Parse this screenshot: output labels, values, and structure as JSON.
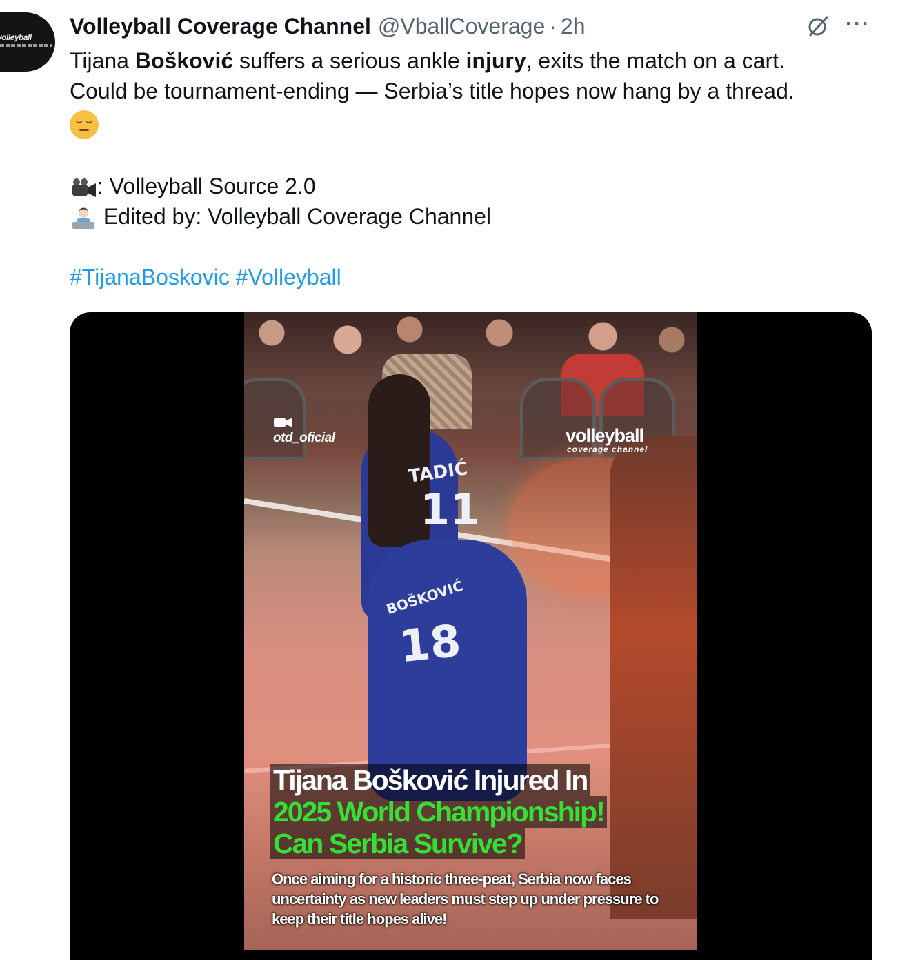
{
  "author": {
    "display_name": "Volleyball Coverage Channel",
    "handle": "@VballCoverage",
    "separator": "·",
    "timestamp": "2h",
    "avatar_text": "volleyball"
  },
  "actions": {
    "grok_icon": "grok-icon",
    "more_icon": "more-icon",
    "more_label": "···"
  },
  "tweet": {
    "line1": {
      "part1": "Tijana ",
      "bold1": "Bošković",
      "part2": " suffers a serious ankle ",
      "bold2": "injury",
      "part3": ", exits the match on a cart."
    },
    "line2": "Could be tournament-ending — Serbia’s title hopes now hang by a thread.",
    "emoji_pensive": "pensive-face-emoji",
    "credit_source": ": Volleyball Source 2.0",
    "credit_source_icon": "video-camera-emoji",
    "credit_editor": " Edited by: Volleyball Coverage Channel",
    "credit_editor_icon": "technologist-emoji",
    "hashtags": [
      "#TijanaBoskovic",
      "#Volleyball"
    ]
  },
  "media": {
    "watermark_left": "otd_oficial",
    "watermark_right": "volleyball",
    "watermark_right_sub": "coverage channel",
    "jersey_name_top": "TADIĆ",
    "jersey_number_top": "11",
    "jersey_name_bottom": "BOŠKOVIĆ",
    "jersey_number_bottom": "18",
    "title_line1": "Tijana Bošković Injured In",
    "title_line2": "2025 World Championship!",
    "title_line3": "Can Serbia Survive?",
    "subtitle": "Once aiming for a historic three-peat, Serbia now faces uncertainty as new leaders must step up under pressure to keep their title hopes alive!",
    "colors": {
      "title_white": "#ffffff",
      "title_green": "#35e035"
    }
  },
  "colors": {
    "link": "#1d9bf0",
    "secondary_text": "#536471",
    "primary_text": "#0f1419"
  }
}
